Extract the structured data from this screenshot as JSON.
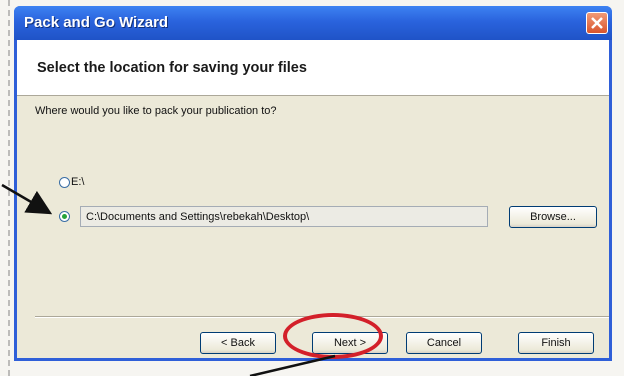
{
  "window": {
    "title": "Pack and Go Wizard"
  },
  "header": {
    "title": "Select the location for saving your files"
  },
  "body": {
    "question": "Where would you like to pack your publication to?",
    "options": [
      {
        "label": "E:\\",
        "selected": false
      },
      {
        "value": "C:\\Documents and Settings\\rebekah\\Desktop\\",
        "selected": true
      }
    ],
    "browse_label": "Browse..."
  },
  "footer": {
    "back_label": "< Back",
    "next_label": "Next >",
    "cancel_label": "Cancel",
    "finish_label": "Finish"
  },
  "colors": {
    "titlebar": "#2a63dd",
    "highlight": "#d3202a",
    "dialog_bg": "#ece9d8"
  }
}
